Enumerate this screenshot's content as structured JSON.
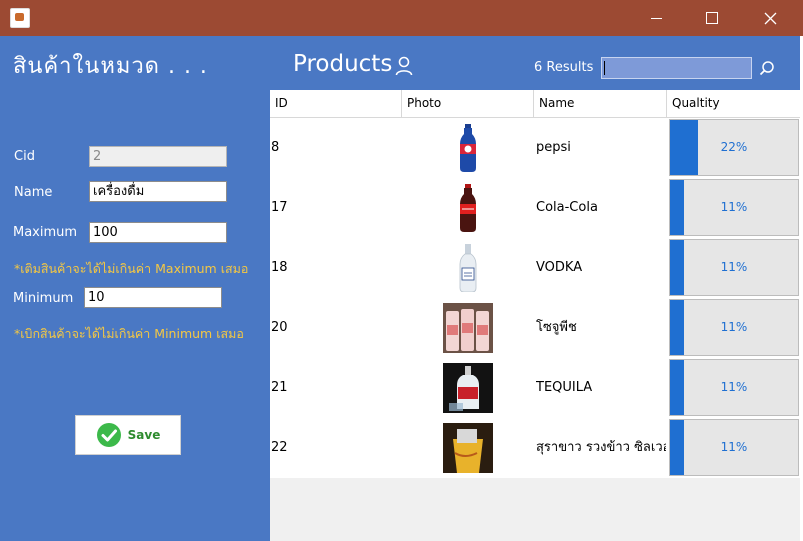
{
  "left": {
    "category_title": "สินค้าในหมวด . . .",
    "cid_label": "Cid",
    "cid_value": "2",
    "name_label": "Name",
    "name_value": "เครื่องดื่ม",
    "maximum_label": "Maximum",
    "maximum_value": "100",
    "max_note": "*เติมสินค้าจะได้ไม่เกินค่า Maximum เสมอ",
    "minimum_label": "Minimum",
    "minimum_value": "10",
    "min_note": "*เบิกสินค้าจะได้ไม่เกินค่า Minimum เสมอ",
    "save_label": "Save"
  },
  "header": {
    "title": "Products",
    "results": "6 Results",
    "search_value": ""
  },
  "table": {
    "columns": [
      "ID",
      "Photo",
      "Name",
      "Qualtity"
    ],
    "rows": [
      {
        "id": "8",
        "name": "pepsi",
        "photo": "pepsi-bottle",
        "quantity_text": "22%",
        "quantity_fraction": 0.22
      },
      {
        "id": "17",
        "name": "Cola-Cola",
        "photo": "cola-bottle",
        "quantity_text": "11%",
        "quantity_fraction": 0.11
      },
      {
        "id": "18",
        "name": "VODKA",
        "photo": "vodka-bottle",
        "quantity_text": "11%",
        "quantity_fraction": 0.11
      },
      {
        "id": "20",
        "name": "โซจูพีช",
        "photo": "soju-cans",
        "quantity_text": "11%",
        "quantity_fraction": 0.11
      },
      {
        "id": "21",
        "name": "TEQUILA",
        "photo": "tequila-bottle",
        "quantity_text": "11%",
        "quantity_fraction": 0.11
      },
      {
        "id": "22",
        "name": "สุราขาว รวงข้าว ซิลเวอร์",
        "photo": "rice-liquor",
        "quantity_text": "11%",
        "quantity_fraction": 0.11
      }
    ]
  },
  "colors": {
    "titlebar": "#9c4a33",
    "panel": "#4a78c4",
    "note": "#f5c842",
    "progress": "#1f6fd1"
  }
}
